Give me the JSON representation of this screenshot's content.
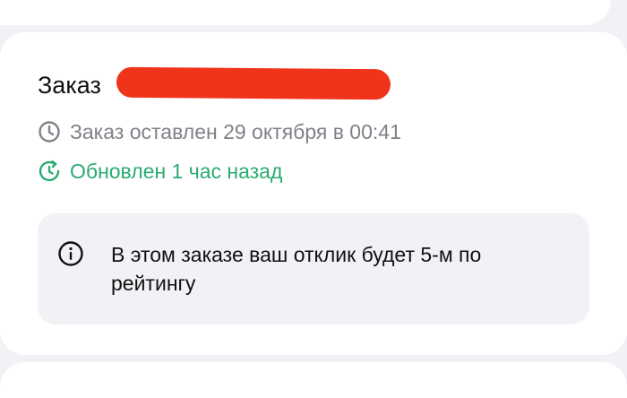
{
  "order": {
    "title": "Заказ",
    "placed_text": "Заказ оставлен 29 октября в 00:41",
    "updated_text": "Обновлен 1 час назад"
  },
  "info": {
    "message": "В этом заказе ваш отклик будет 5-м по рейтингу"
  },
  "icons": {
    "placed": "clock-icon",
    "updated": "refresh-clock-icon",
    "info": "info-icon"
  },
  "colors": {
    "updated_green": "#2bab72",
    "muted_gray": "#808089",
    "redaction_red": "#f0341c"
  }
}
